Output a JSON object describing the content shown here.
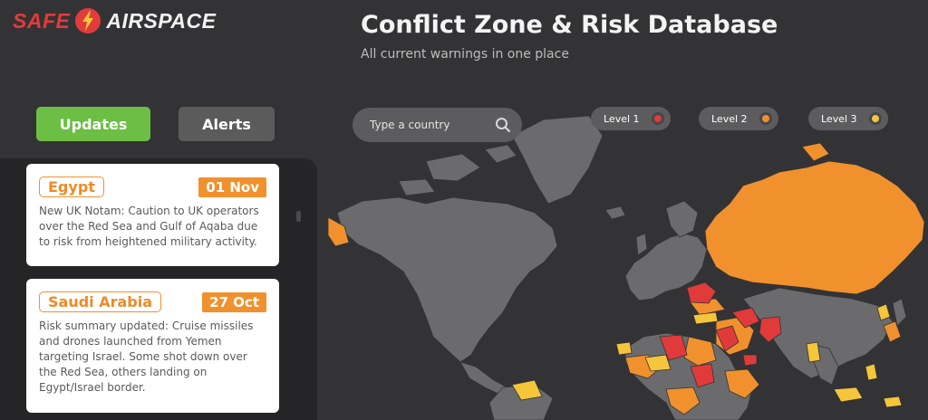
{
  "header": {
    "logo_left": "SAFE",
    "logo_right": "AIRSPACE",
    "title": "Conflict Zone & Risk Database",
    "subtitle": "All current warnings in one place"
  },
  "tabs": [
    {
      "label": "Updates",
      "active": true
    },
    {
      "label": "Alerts",
      "active": false
    }
  ],
  "updates": [
    {
      "country": "Egypt",
      "date": "01 Nov",
      "text": "New UK Notam: Caution to UK operators over the Red Sea and Gulf of Aqaba due to risk from heightened military activity."
    },
    {
      "country": "Saudi Arabia",
      "date": "27 Oct",
      "text": "Risk summary updated: Cruise missiles and drones launched from Yemen targeting Israel. Some shot down over the Red Sea, others landing on Egypt/Israel border."
    }
  ],
  "search": {
    "placeholder": "Type a country"
  },
  "legend": [
    {
      "label": "Level 1",
      "color": "#e03a3a"
    },
    {
      "label": "Level 2",
      "color": "#f0912d"
    },
    {
      "label": "Level 3",
      "color": "#f5c53a"
    }
  ],
  "colors": {
    "accent_green": "#6cbe45",
    "brand_red": "#e23b3b",
    "land": "#6b6b6d",
    "level1": "#e03a3a",
    "level2": "#f0912d",
    "level3": "#f5c53a"
  },
  "icons": {
    "logo": "lightning-bolt-icon",
    "search": "search-icon"
  }
}
